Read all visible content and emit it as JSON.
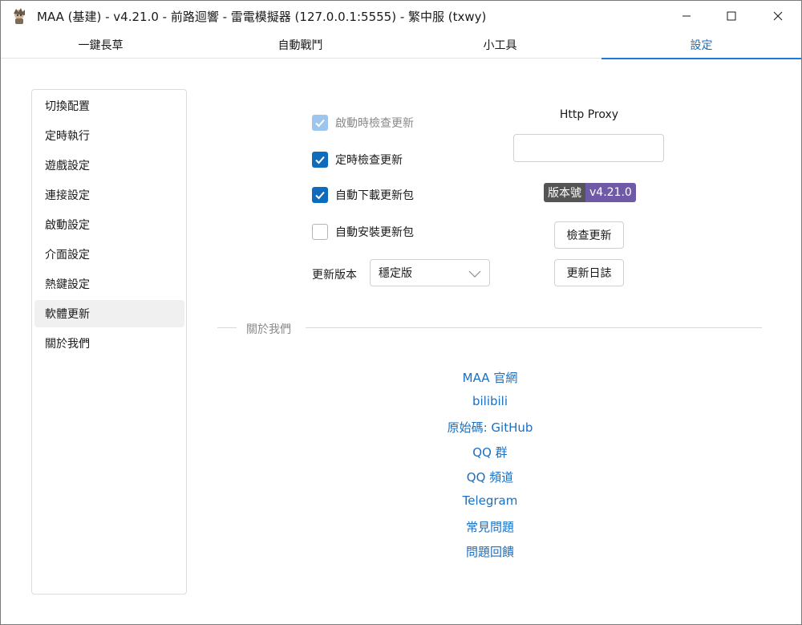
{
  "window": {
    "title": "MAA (基建) - v4.21.0 - 前路迴響 - 雷電模擬器 (127.0.0.1:5555) - 繁中服 (txwy)",
    "app_icon": "maa-character-icon",
    "controls": [
      "minimize-icon",
      "maximize-icon",
      "close-icon"
    ]
  },
  "tabs": [
    {
      "label": "一鍵長草",
      "active": false
    },
    {
      "label": "自動戰鬥",
      "active": false
    },
    {
      "label": "小工具",
      "active": false
    },
    {
      "label": "設定",
      "active": true
    }
  ],
  "sidebar": {
    "items": [
      {
        "label": "切換配置"
      },
      {
        "label": "定時執行"
      },
      {
        "label": "遊戲設定"
      },
      {
        "label": "連接設定"
      },
      {
        "label": "啟動設定"
      },
      {
        "label": "介面設定"
      },
      {
        "label": "熱鍵設定"
      },
      {
        "label": "軟體更新",
        "active": true
      },
      {
        "label": "關於我們"
      }
    ]
  },
  "update": {
    "options": [
      {
        "label": "啟動時檢查更新",
        "state": "checked-disabled"
      },
      {
        "label": "定時檢查更新",
        "state": "checked"
      },
      {
        "label": "自動下載更新包",
        "state": "checked"
      },
      {
        "label": "自動安裝更新包",
        "state": "unchecked"
      }
    ],
    "version_type_label": "更新版本",
    "version_type_value": "穩定版",
    "proxy_label": "Http Proxy",
    "proxy_value": "",
    "badge_label": "版本號",
    "badge_value": "v4.21.0",
    "check_button": "檢查更新",
    "changelog_button": "更新日誌",
    "colors": {
      "accent": "#0f6cbd",
      "badge_left": "#555555",
      "badge_right": "#6f5aa8",
      "link": "#1a6fc0"
    }
  },
  "about": {
    "heading": "關於我們",
    "links": [
      "MAA 官網",
      "bilibili",
      "原始碼: GitHub",
      "QQ 群",
      "QQ 頻道",
      "Telegram",
      "常見問題",
      "問題回饋"
    ]
  }
}
